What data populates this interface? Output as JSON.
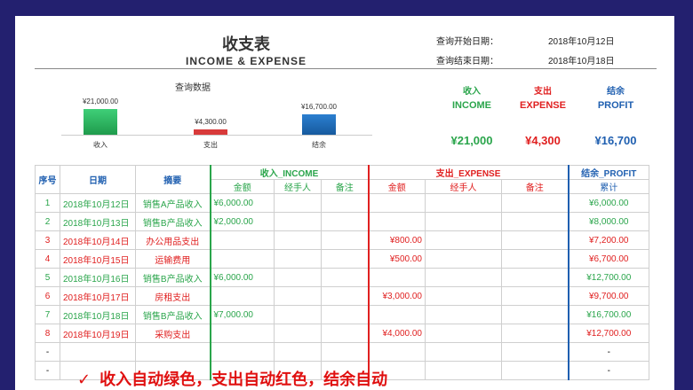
{
  "header": {
    "title_cn": "收支表",
    "title_en": "INCOME & EXPENSE",
    "query_start_label": "查询开始日期：",
    "query_start_value": "2018年10月12日",
    "query_end_label": "查询结束日期：",
    "query_end_value": "2018年10月18日"
  },
  "chart_data": {
    "type": "bar",
    "title": "查询数据",
    "categories": [
      "收入",
      "支出",
      "结余"
    ],
    "values": [
      21000,
      4300,
      16700
    ],
    "value_labels": [
      "¥21,000.00",
      "¥4,300.00",
      "¥16,700.00"
    ],
    "colors": [
      "#2bb45a",
      "#d83a3a",
      "#1e6fb8"
    ]
  },
  "summary": [
    {
      "cn": "收入",
      "en": "INCOME",
      "amount": "¥21,000",
      "color": "#2aa54b"
    },
    {
      "cn": "支出",
      "en": "EXPENSE",
      "amount": "¥4,300",
      "color": "#e02020"
    },
    {
      "cn": "结余",
      "en": "PROFIT",
      "amount": "¥16,700",
      "color": "#1f5fb0"
    }
  ],
  "table": {
    "h_no": "序号",
    "h_date": "日期",
    "h_desc": "摘要",
    "h_income": "收入_INCOME",
    "h_expense": "支出_EXPENSE",
    "h_profit": "结余_PROFIT",
    "h_amount": "金额",
    "h_handler": "经手人",
    "h_note": "备注",
    "h_cum": "累计",
    "rows": [
      {
        "no": "1",
        "date": "2018年10月12日",
        "desc": "销售A产品收入",
        "income": "¥6,000.00",
        "expense": "",
        "cum": "¥6,000.00",
        "type": "g"
      },
      {
        "no": "2",
        "date": "2018年10月13日",
        "desc": "销售B产品收入",
        "income": "¥2,000.00",
        "expense": "",
        "cum": "¥8,000.00",
        "type": "g"
      },
      {
        "no": "3",
        "date": "2018年10月14日",
        "desc": "办公用品支出",
        "income": "",
        "expense": "¥800.00",
        "cum": "¥7,200.00",
        "type": "r"
      },
      {
        "no": "4",
        "date": "2018年10月15日",
        "desc": "运输费用",
        "income": "",
        "expense": "¥500.00",
        "cum": "¥6,700.00",
        "type": "r"
      },
      {
        "no": "5",
        "date": "2018年10月16日",
        "desc": "销售B产品收入",
        "income": "¥6,000.00",
        "expense": "",
        "cum": "¥12,700.00",
        "type": "g"
      },
      {
        "no": "6",
        "date": "2018年10月17日",
        "desc": "房租支出",
        "income": "",
        "expense": "¥3,000.00",
        "cum": "¥9,700.00",
        "type": "r"
      },
      {
        "no": "7",
        "date": "2018年10月18日",
        "desc": "销售B产品收入",
        "income": "¥7,000.00",
        "expense": "",
        "cum": "¥16,700.00",
        "type": "g"
      },
      {
        "no": "8",
        "date": "2018年10月19日",
        "desc": "采购支出",
        "income": "",
        "expense": "¥4,000.00",
        "cum": "¥12,700.00",
        "type": "r"
      },
      {
        "no": "-",
        "date": "",
        "desc": "",
        "income": "",
        "expense": "",
        "cum": "-",
        "type": "n"
      },
      {
        "no": "-",
        "date": "",
        "desc": "",
        "income": "",
        "expense": "",
        "cum": "-",
        "type": "n"
      }
    ]
  },
  "note": {
    "check": "✓",
    "text": "收入自动绿色，支出自动红色，结余自动"
  }
}
